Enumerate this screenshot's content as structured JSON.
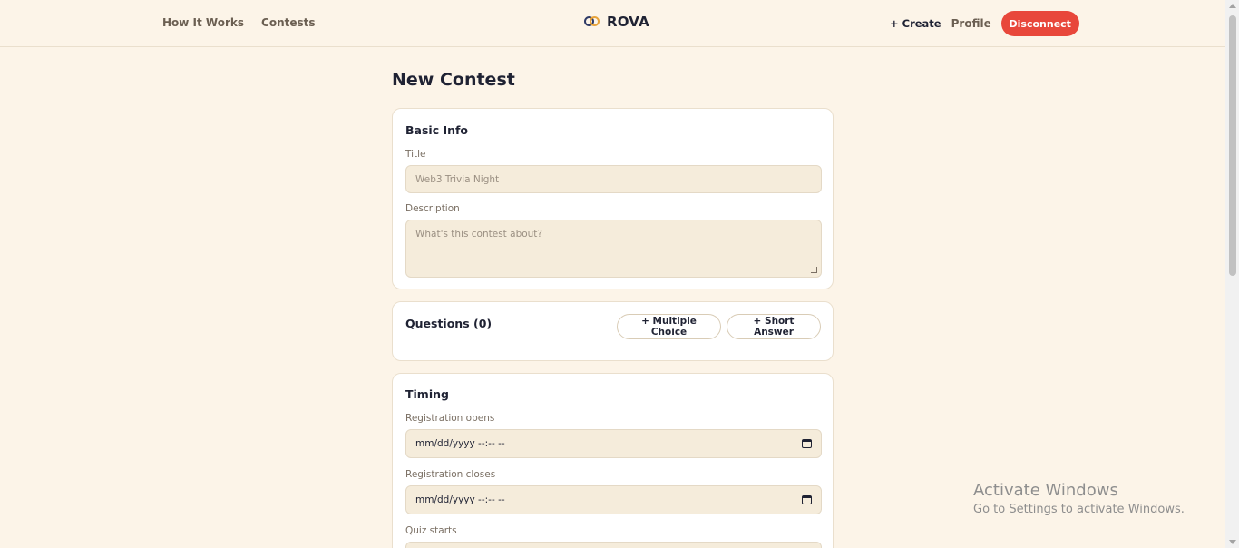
{
  "nav": {
    "how_it_works": "How It Works",
    "contests": "Contests",
    "brand": "ROVA",
    "create": "+ Create",
    "profile": "Profile",
    "disconnect": "Disconnect"
  },
  "page": {
    "title": "New Contest"
  },
  "basic_info": {
    "heading": "Basic Info",
    "title_label": "Title",
    "title_placeholder": "Web3 Trivia Night",
    "description_label": "Description",
    "description_placeholder": "What's this contest about?"
  },
  "questions": {
    "heading": "Questions (0)",
    "multiple_choice_button": "+ Multiple Choice",
    "short_answer_button": "+ Short Answer"
  },
  "timing": {
    "heading": "Timing",
    "registration_opens_label": "Registration opens",
    "registration_opens_value": "mm/dd/yyyy --:-- --",
    "registration_closes_label": "Registration closes",
    "registration_closes_value": "mm/dd/yyyy --:-- --",
    "quiz_starts_label": "Quiz starts"
  },
  "watermark": {
    "title": "Activate Windows",
    "subtitle": "Go to Settings to activate Windows."
  },
  "colors": {
    "background": "#fcf4e8",
    "accent_red": "#e8473b",
    "field_bg": "#f5ecdb",
    "text_dark": "#1f2233"
  }
}
